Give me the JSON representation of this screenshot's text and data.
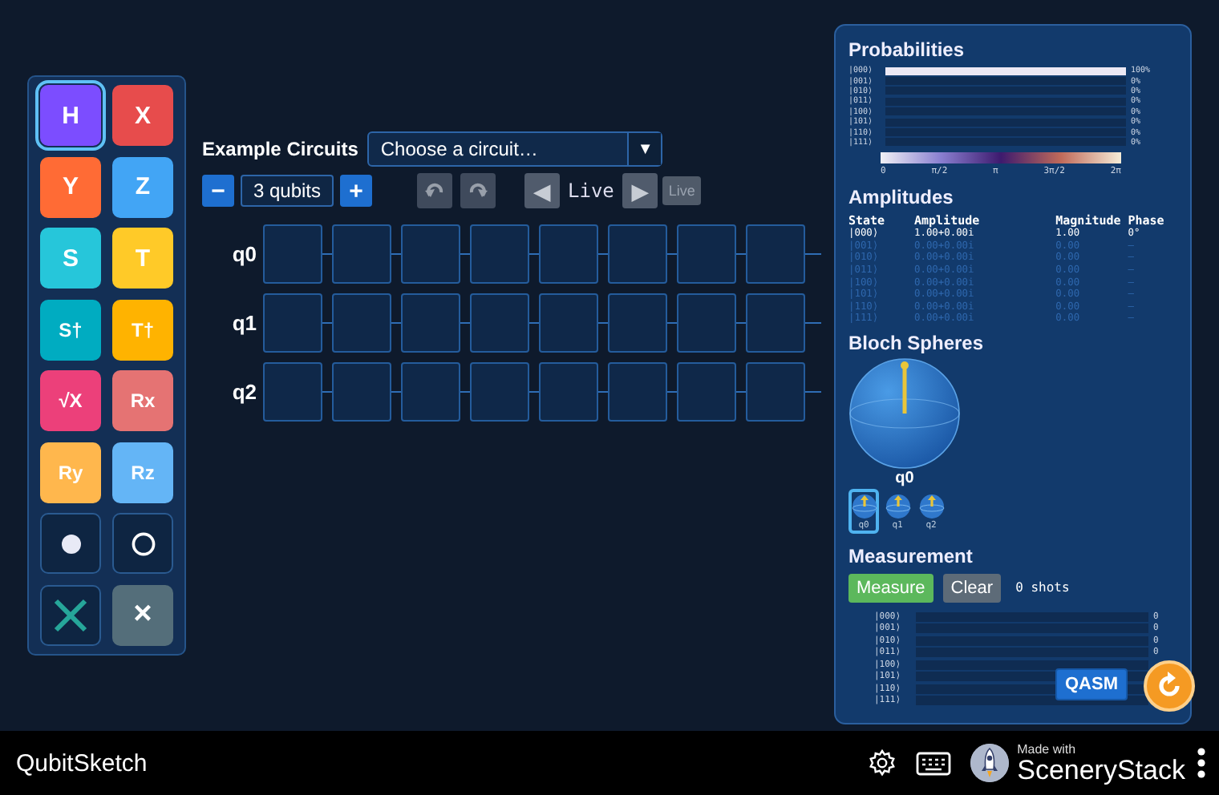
{
  "palette": {
    "gates": [
      {
        "kind": "gate",
        "label": "H",
        "color": "#7c4dff",
        "selected": true
      },
      {
        "kind": "gate",
        "label": "X",
        "color": "#e74c4c",
        "selected": false
      },
      {
        "kind": "gate",
        "label": "Y",
        "color": "#ff6b35",
        "selected": false
      },
      {
        "kind": "gate",
        "label": "Z",
        "color": "#42a5f5",
        "selected": false
      },
      {
        "kind": "gate",
        "label": "S",
        "color": "#26c6da",
        "selected": false
      },
      {
        "kind": "gate",
        "label": "T",
        "color": "#ffca28",
        "selected": false
      },
      {
        "kind": "gate",
        "label": "S†",
        "color": "#00acc1",
        "selected": false
      },
      {
        "kind": "gate",
        "label": "T†",
        "color": "#ffb300",
        "selected": false
      },
      {
        "kind": "gate",
        "label": "√X",
        "color": "#ec407a",
        "selected": false
      },
      {
        "kind": "gate",
        "label": "Rx",
        "color": "#e57373",
        "selected": false
      },
      {
        "kind": "gate",
        "label": "Ry",
        "color": "#ffb74d",
        "selected": false
      },
      {
        "kind": "gate",
        "label": "Rz",
        "color": "#64b5f6",
        "selected": false
      },
      {
        "kind": "control",
        "selected": false
      },
      {
        "kind": "anticontrol",
        "selected": false
      },
      {
        "kind": "swap",
        "selected": false
      },
      {
        "kind": "delete",
        "label": "×",
        "selected": false
      }
    ]
  },
  "examples": {
    "label": "Example Circuits",
    "value": "Choose a circuit…",
    "caret": "▼"
  },
  "qubit_controls": {
    "minus": "−",
    "count": "3 qubits",
    "plus": "+"
  },
  "history": {
    "undo_disabled": true,
    "redo_disabled": true
  },
  "stepper": {
    "back": "◀",
    "mode": "Live",
    "forward": "▶",
    "live_button": {
      "label": "Live",
      "disabled": true
    }
  },
  "circuit": {
    "rows": [
      {
        "label": "q0",
        "cells": [
          {
            "empty": true
          },
          {
            "empty": true
          },
          {
            "empty": true
          },
          {
            "empty": true
          },
          {
            "empty": true
          },
          {
            "empty": true
          },
          {
            "empty": true
          },
          {
            "empty": true
          }
        ]
      },
      {
        "label": "q1",
        "cells": [
          {
            "empty": true
          },
          {
            "empty": true
          },
          {
            "empty": true
          },
          {
            "empty": true
          },
          {
            "empty": true
          },
          {
            "empty": true
          },
          {
            "empty": true
          },
          {
            "empty": true
          }
        ]
      },
      {
        "label": "q2",
        "cells": [
          {
            "empty": true
          },
          {
            "empty": true
          },
          {
            "empty": true
          },
          {
            "empty": true
          },
          {
            "empty": true
          },
          {
            "empty": true
          },
          {
            "empty": true
          },
          {
            "empty": true
          }
        ]
      }
    ]
  },
  "probabilities": {
    "title": "Probabilities",
    "rows": [
      {
        "state": "|000⟩",
        "level": 1,
        "reading": "100%"
      },
      {
        "state": "|001⟩",
        "level": 0,
        "reading": "0%"
      },
      {
        "state": "|010⟩",
        "level": 0,
        "reading": "0%"
      },
      {
        "state": "|011⟩",
        "level": 0,
        "reading": "0%"
      },
      {
        "state": "|100⟩",
        "level": 0,
        "reading": "0%"
      },
      {
        "state": "|101⟩",
        "level": 0,
        "reading": "0%"
      },
      {
        "state": "|110⟩",
        "level": 0,
        "reading": "0%"
      },
      {
        "state": "|111⟩",
        "level": 0,
        "reading": "0%"
      }
    ],
    "phase_scale": [
      "0",
      "π/2",
      "π",
      "3π/2",
      "2π"
    ]
  },
  "amplitudes": {
    "title": "Amplitudes",
    "columns": [
      "State",
      "Amplitude",
      "Magnitude",
      "Phase"
    ],
    "rows": [
      {
        "state": "|000⟩",
        "amplitude": "1.00+0.00i",
        "magnitude": "1.00",
        "phase": "0°",
        "active": true
      },
      {
        "state": "|001⟩",
        "amplitude": "0.00+0.00i",
        "magnitude": "0.00",
        "phase": "–",
        "active": false
      },
      {
        "state": "|010⟩",
        "amplitude": "0.00+0.00i",
        "magnitude": "0.00",
        "phase": "–",
        "active": false
      },
      {
        "state": "|011⟩",
        "amplitude": "0.00+0.00i",
        "magnitude": "0.00",
        "phase": "–",
        "active": false
      },
      {
        "state": "|100⟩",
        "amplitude": "0.00+0.00i",
        "magnitude": "0.00",
        "phase": "–",
        "active": false
      },
      {
        "state": "|101⟩",
        "amplitude": "0.00+0.00i",
        "magnitude": "0.00",
        "phase": "–",
        "active": false
      },
      {
        "state": "|110⟩",
        "amplitude": "0.00+0.00i",
        "magnitude": "0.00",
        "phase": "–",
        "active": false
      },
      {
        "state": "|111⟩",
        "amplitude": "0.00+0.00i",
        "magnitude": "0.00",
        "phase": "–",
        "active": false
      }
    ]
  },
  "bloch": {
    "title": "Bloch Spheres",
    "main_label": "q0",
    "qubits": [
      {
        "label": "q0",
        "selected": true
      },
      {
        "label": "q1",
        "selected": false
      },
      {
        "label": "q2",
        "selected": false
      }
    ]
  },
  "measurement": {
    "title": "Measurement",
    "measure": "Measure",
    "clear": "Clear",
    "shots": "0 shots",
    "rows": [
      {
        "state": "|000⟩",
        "level": 0,
        "count": "0"
      },
      {
        "state": "|001⟩",
        "level": 0,
        "count": "0"
      },
      {
        "state": "|010⟩",
        "level": 0,
        "count": "0"
      },
      {
        "state": "|011⟩",
        "level": 0,
        "count": "0"
      },
      {
        "state": "|100⟩",
        "level": 0
      },
      {
        "state": "|101⟩",
        "level": 0
      },
      {
        "state": "|110⟩",
        "level": 0
      },
      {
        "state": "|111⟩",
        "level": 0
      }
    ],
    "qasm": "QASM"
  },
  "footer": {
    "title": "QubitSketch",
    "made_with": "Made with",
    "brand": "SceneryStack"
  }
}
